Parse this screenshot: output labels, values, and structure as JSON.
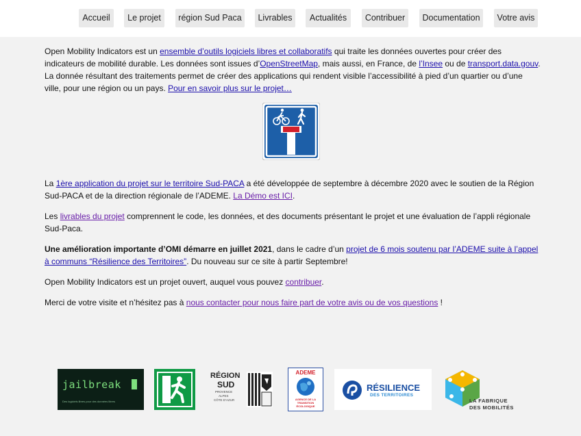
{
  "nav": {
    "items": [
      "Accueil",
      "Le projet",
      "région Sud Paca",
      "Livrables",
      "Actualités",
      "Contribuer",
      "Documentation",
      "Votre avis"
    ]
  },
  "intro": {
    "t1": "Open Mobility Indicators est un ",
    "l1": "ensemble d’outils logiciels libres et collaboratifs",
    "t2": " qui traite les données ouvertes pour créer des indicateurs de mobilité durable. Les données sont issues d’",
    "l2": "OpenStreetMap",
    "t3": ", mais aussi, en France, de ",
    "l3": "l’Insee",
    "t4": " ou de ",
    "l4": "transport.data.gouv",
    "t5": ". La donnée résultant des traitements permet de créer des applications qui rendent visible l’accessibilité à pied d’un quartier ou d’une ville, pour une région ou un pays. ",
    "l5": "Pour en savoir plus sur le projet…"
  },
  "sudpaca": {
    "t1": "La ",
    "l1": "1ère application du projet sur le territoire Sud-PACA",
    "t2": " a été développée de septembre à décembre 2020 avec le soutien de la Région Sud-PACA et de la direction régionale de l’ADEME. ",
    "l2": "La Démo est ICI",
    "t3": "."
  },
  "livrables": {
    "t1": "Les ",
    "l1": "livrables du projet",
    "t2": " comprennent le code, les données, et des documents présentant le projet et une évaluation de l’appli régionale Sud-Paca."
  },
  "amelioration": {
    "bold": "Une amélioration importante d’OMI démarre en juillet 2021",
    "t1": ", dans le cadre d’un ",
    "l1": "projet de 6 mois soutenu par l’ADEME suite à l’appel à communs “Résilience des Territoires”",
    "t2": ". Du nouveau sur ce site à partir Septembre!"
  },
  "ouvert": {
    "t1": "Open Mobility Indicators est un projet ouvert, auquel vous pouvez ",
    "l1": "contribuer",
    "t2": "."
  },
  "merci": {
    "t1": "Merci de votre visite et n’hésitez pas à ",
    "l1": "nous contacter pour nous faire part de votre avis ou de vos questions",
    "t2": " !"
  },
  "logos": {
    "jailbreak": {
      "name": "jailbreak",
      "tagline": "Des logiciels libres pour des données libres"
    },
    "region": {
      "line1": "RÉGION",
      "line2": "SUD",
      "line3": "PROVENCE",
      "line4": "ALPES",
      "line5": "CÔTE D’AZUR"
    },
    "ademe": {
      "name": "ADEME",
      "sub1": "AGENCE DE LA",
      "sub2": "TRANSITION",
      "sub3": "ÉCOLOGIQUE"
    },
    "resilience": {
      "title": "RÉSILIENCE",
      "sub": "DES TERRITOIRES"
    },
    "fabrique": {
      "line1": "LA FABRIQUE",
      "line2": "DES MOBILITÉS"
    }
  },
  "colors": {
    "link": "#1a0dab",
    "visited": "#681da8",
    "sign_blue": "#1d5fa8",
    "sign_red": "#d3202a"
  }
}
